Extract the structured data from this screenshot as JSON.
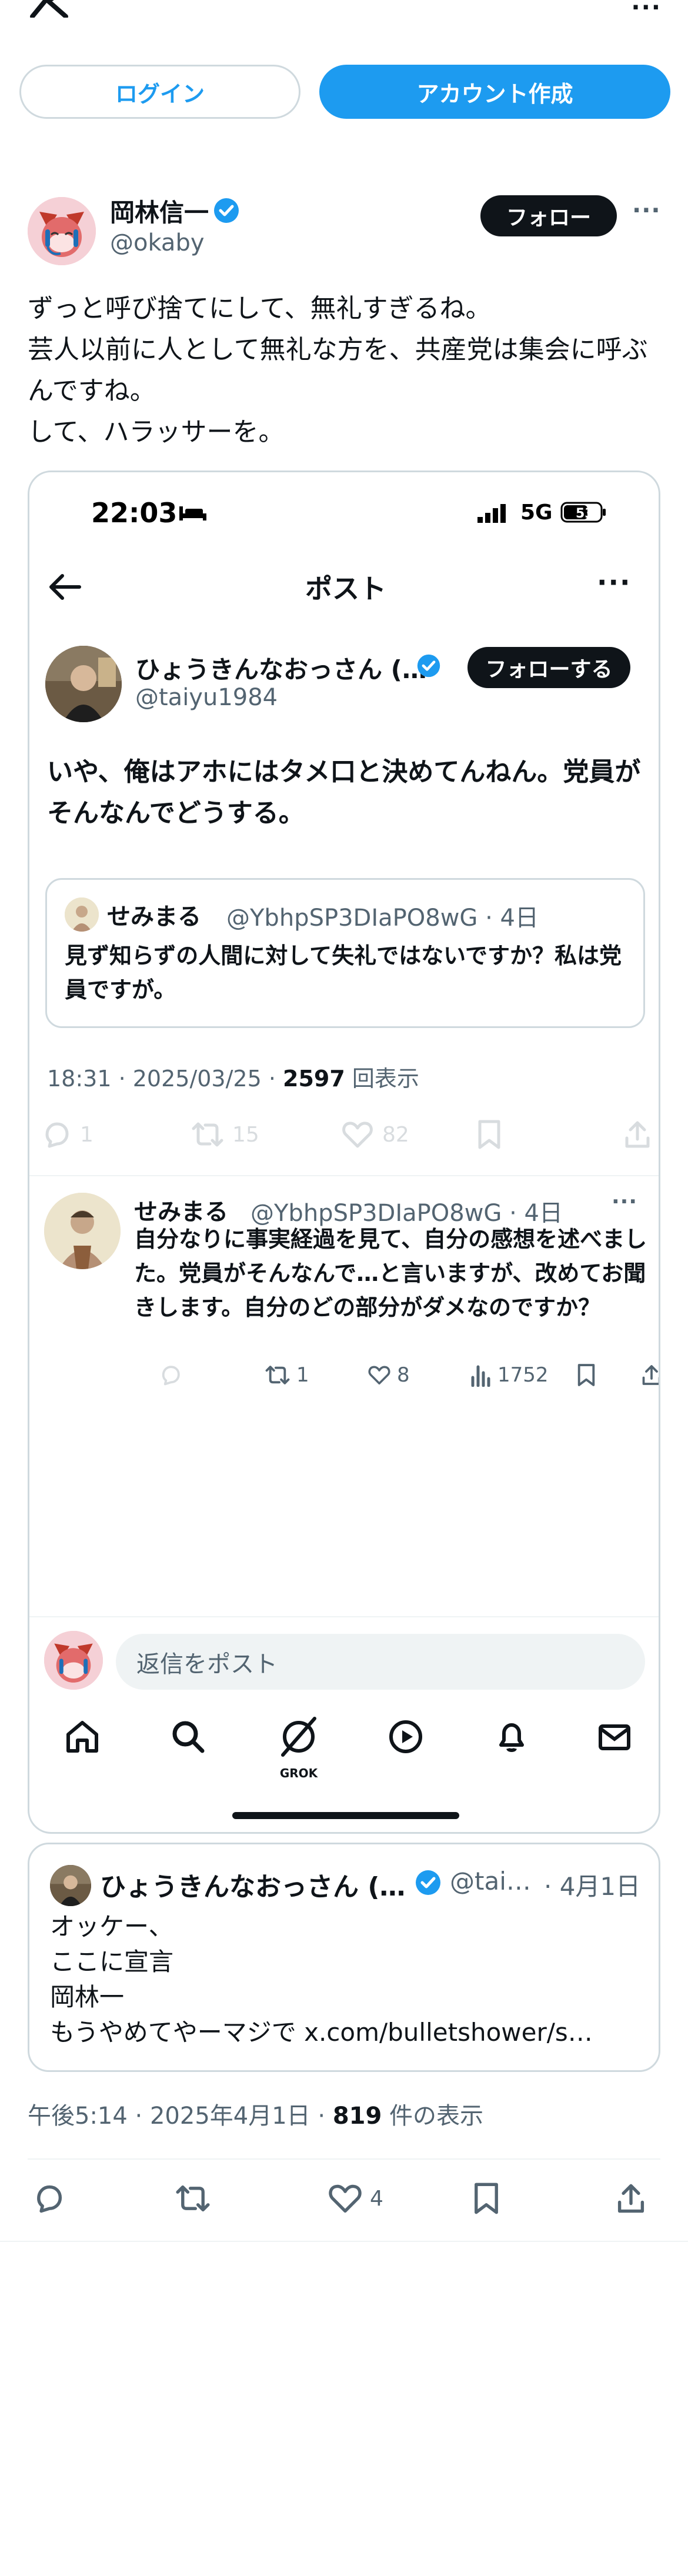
{
  "topbar": {
    "logo_icon": "x-logo-icon",
    "more_label": "···"
  },
  "auth": {
    "login_label": "ログイン",
    "signup_label": "アカウント作成"
  },
  "post": {
    "author_name": "岡林信一",
    "author_handle": "@okaby",
    "follow_label": "フォロー",
    "more_label": "···",
    "text": "ずっと呼び捨てにして、無礼すぎるね。\n芸人以前に人として無礼な方を、共産党は集会に呼ぶんですね。\nして、ハラッサーを。",
    "meta_time": "午後5:14 · 2025年4月1日 · ",
    "meta_views": "819",
    "meta_views_suffix": " 件の表示",
    "like_count": "4"
  },
  "screenshot": {
    "status_time": "22:03",
    "network": "5G",
    "battery": "53",
    "nav_title": "ポスト",
    "nav_more": "···",
    "tweet": {
      "author_name": "ひょうきんなおっさん (…",
      "author_handle": "@taiyu1984",
      "follow_label": "フォローする",
      "text": "いや、俺はアホにはタメ口と決めてんねん。党員がそんなんでどうする。",
      "meta_time": "18:31 · 2025/03/25 · ",
      "meta_views": "2597",
      "meta_views_suffix": " 回表示",
      "reply_count": "1",
      "repost_count": "15",
      "like_count": "82"
    },
    "quote": {
      "author_name": "せみまる",
      "author_handle": "@YbhpSP3DIaPO8wG · 4日",
      "text": "見ず知らずの人間に対して失礼ではないですか？私は党員ですが。"
    },
    "reply": {
      "author_name": "せみまる",
      "author_handle": "@YbhpSP3DIaPO8wG · 4日",
      "more_label": "···",
      "text": "自分なりに事実経過を見て、自分の感想を述べました。党員がそんなんで…と言いますが、改めてお聞きします。自分のどの部分がダメなのですか？",
      "repost_count": "1",
      "like_count": "8",
      "views_count": "1752"
    },
    "reply_placeholder": "返信をポスト",
    "tabs": [
      "home-icon",
      "search-icon",
      "grok-icon",
      "video-icon",
      "bell-icon",
      "mail-icon"
    ],
    "grok_label": "GROK"
  },
  "quote_card": {
    "author_name": "ひょうきんなおっさん (…",
    "author_handle": "@tai…",
    "date": "· 4月1日",
    "text": "オッケー、\nここに宣言\n岡林一\nもうやめてやーマジで x.com/bulletshower/s…"
  },
  "colors": {
    "accent": "#1d9bf0",
    "text": "#0f1419",
    "muted": "#536471",
    "border": "#cfd9de"
  }
}
